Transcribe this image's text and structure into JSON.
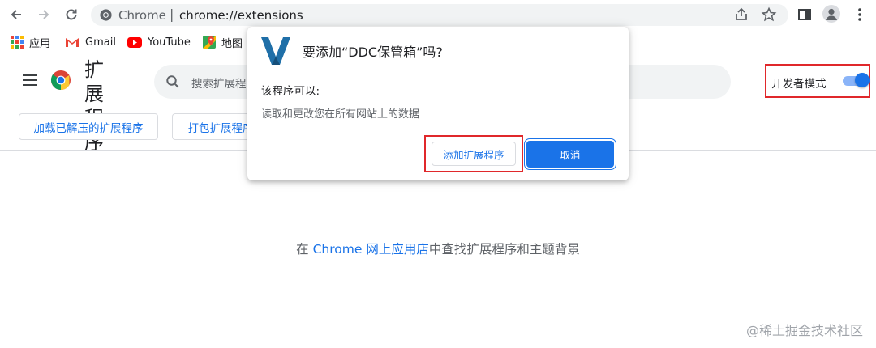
{
  "browser": {
    "omnibox_site": "Chrome",
    "omnibox_separator": "|",
    "url": "chrome://extensions"
  },
  "bookmarks": [
    {
      "label": "应用",
      "icon": "apps-grid-icon"
    },
    {
      "label": "Gmail",
      "icon": "gmail-icon"
    },
    {
      "label": "YouTube",
      "icon": "youtube-icon"
    },
    {
      "label": "地图",
      "icon": "maps-icon"
    }
  ],
  "header": {
    "title": "扩展程序",
    "search_placeholder": "搜索扩展程序",
    "dev_mode_label": "开发者模式",
    "dev_mode_on": true
  },
  "actions": {
    "load_unpacked": "加载已解压的扩展程序",
    "pack": "打包扩展程序"
  },
  "empty_message": {
    "prefix": "在 ",
    "link": "Chrome 网上应用店",
    "suffix": "中查找扩展程序和主题背景"
  },
  "dialog": {
    "title": "要添加“DDC保管箱”吗?",
    "subtitle": "该程序可以:",
    "permission": "读取和更改您在所有网站上的数据",
    "add_button": "添加扩展程序",
    "cancel_button": "取消"
  },
  "watermark": "@稀土掘金技术社区",
  "colors": {
    "accent": "#1a73e8",
    "highlight_border": "#e0282b",
    "logo_blue": "#1f6fa8"
  }
}
